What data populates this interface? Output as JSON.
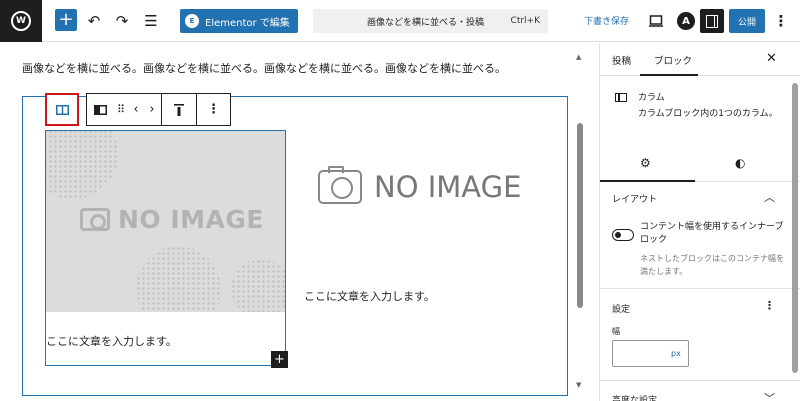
{
  "topbar": {
    "add_label": "+",
    "elementor_icon": "E",
    "elementor_label": "Elementor で編集",
    "command_title": "画像などを横に並べる・投稿",
    "command_shortcut": "Ctrl+K",
    "save_draft": "下書き保存",
    "publish": "公開"
  },
  "canvas": {
    "paragraph": "画像などを横に並べる。画像などを横に並べる。画像などを横に並べる。画像などを横に並べる。",
    "left_image_text": "NO IMAGE",
    "right_image_text": "NO IMAGE",
    "left_column_text": "ここに文章を入力します。",
    "right_column_text": "ここに文章を入力します。",
    "inserter_label": "+"
  },
  "sidebar": {
    "tabs": [
      "投稿",
      "ブロック"
    ],
    "block_card": {
      "title": "カラム",
      "description": "カラムブロック内の1つのカラム。"
    },
    "layout": {
      "title": "レイアウト",
      "toggle_label": "コンテント幅を使用するインナーブロック",
      "toggle_help": "ネストしたブロックはこのコンテナ幅を満たします。"
    },
    "settings": {
      "title": "設定",
      "width_label": "幅",
      "width_value": "",
      "width_unit": "px"
    },
    "advanced": {
      "title": "高度な設定"
    }
  },
  "colors": {
    "accent": "#2271b1",
    "dark": "#1e1e1e",
    "highlight": "#cc1818"
  }
}
